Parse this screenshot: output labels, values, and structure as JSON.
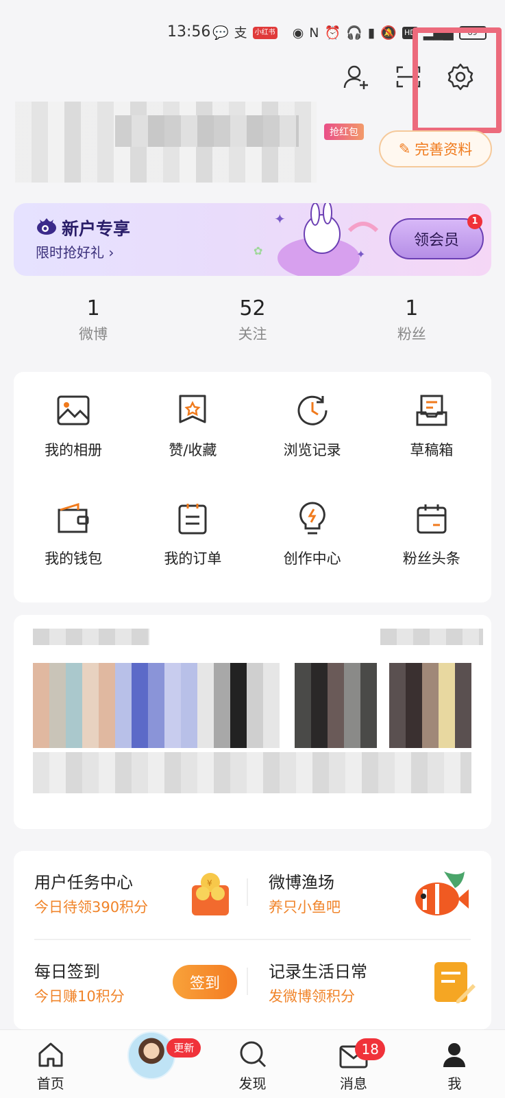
{
  "status": {
    "time": "13:56",
    "icons": [
      "wechat-icon",
      "alipay-icon",
      "app-badge-icon",
      "eye-icon",
      "nfc-icon",
      "alarm-icon",
      "headphones-icon",
      "battery-saver-icon",
      "mute-icon",
      "hd-icon",
      "signal-icon",
      "battery-icon"
    ],
    "app_badge": "小红书",
    "hd": "HD",
    "battery": "89"
  },
  "profile": {
    "redpack_label": "抢红包",
    "edit_label": "完善资料"
  },
  "vip": {
    "title": "新户专享",
    "subtitle": "限时抢好礼 ›",
    "button": "领会员",
    "badge": "1",
    "accent": "#6b3fb3"
  },
  "stats": [
    {
      "value": "1",
      "label": "微博"
    },
    {
      "value": "52",
      "label": "关注"
    },
    {
      "value": "1",
      "label": "粉丝"
    }
  ],
  "grid": [
    {
      "label": "我的相册",
      "icon": "photo-album-icon"
    },
    {
      "label": "赞/收藏",
      "icon": "bookmark-star-icon"
    },
    {
      "label": "浏览记录",
      "icon": "history-clock-icon"
    },
    {
      "label": "草稿箱",
      "icon": "drafts-tray-icon"
    },
    {
      "label": "我的钱包",
      "icon": "wallet-icon"
    },
    {
      "label": "我的订单",
      "icon": "orders-icon"
    },
    {
      "label": "创作中心",
      "icon": "lightbulb-icon"
    },
    {
      "label": "粉丝头条",
      "icon": "calendar-icon"
    }
  ],
  "tasks": [
    {
      "title": "用户任务中心",
      "sub": "今日待领390积分",
      "icon": "coin-bag-icon"
    },
    {
      "title": "微博渔场",
      "sub": "养只小鱼吧",
      "icon": "fish-icon"
    },
    {
      "title": "每日签到",
      "sub": "今日赚10积分",
      "button": "签到"
    },
    {
      "title": "记录生活日常",
      "sub": "发微博领积分",
      "icon": "note-edit-icon"
    }
  ],
  "nav": [
    {
      "label": "首页",
      "icon": "home-icon"
    },
    {
      "label": "",
      "icon": "avatar",
      "badge": "更新"
    },
    {
      "label": "发现",
      "icon": "search-icon"
    },
    {
      "label": "消息",
      "icon": "mail-icon",
      "badge": "18"
    },
    {
      "label": "我",
      "icon": "profile-icon"
    }
  ],
  "colors": {
    "accent_orange": "#f0842a",
    "badge_red": "#f0323a",
    "highlight": "#ec6a7c"
  }
}
